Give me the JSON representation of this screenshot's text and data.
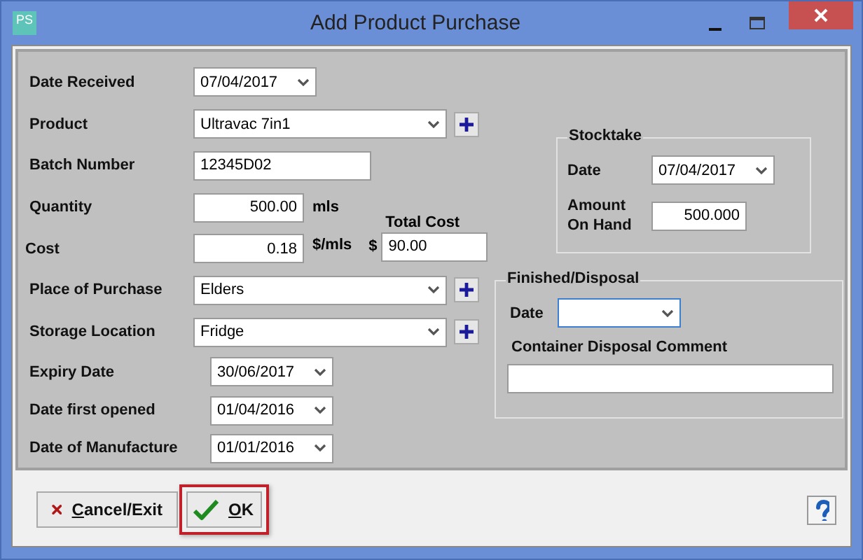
{
  "window": {
    "title": "Add Product Purchase",
    "app_icon_text": "PS"
  },
  "fields": [
    {
      "kind": "date",
      "label": "Date Received",
      "value": "07/04/2017"
    },
    {
      "kind": "combo",
      "label": "Product",
      "value": "Ultravac 7in1",
      "add": true
    },
    {
      "kind": "text",
      "label": "Batch Number",
      "value": "12345D02"
    },
    {
      "kind": "number",
      "label": "Quantity",
      "value": "500.00",
      "unit": "mls"
    },
    {
      "kind": "number",
      "label": "Cost",
      "value": "0.18",
      "unit": "$/mls",
      "total": {
        "label": "Total Cost",
        "currency": "$",
        "value": "90.00"
      }
    },
    {
      "kind": "combo",
      "label": "Place of Purchase",
      "value": "Elders",
      "add": true
    },
    {
      "kind": "combo",
      "label": "Storage Location",
      "value": "Fridge",
      "add": true
    }
  ],
  "dates": [
    {
      "label": "Expiry Date",
      "value": "30/06/2017"
    },
    {
      "label": "Date first opened",
      "value": "01/04/2016"
    },
    {
      "label": "Date of Manufacture",
      "value": "01/01/2016"
    }
  ],
  "stocktake": {
    "title": "Stocktake",
    "date_label": "Date",
    "date": "07/04/2017",
    "amount_label": "Amount On Hand",
    "amount": "500.000"
  },
  "disposal": {
    "title": "Finished/Disposal",
    "date_label": "Date",
    "date_focused": true,
    "comment_label": "Container Disposal Comment"
  },
  "buttons": [
    {
      "kind": "cancel",
      "label": "Cancel/Exit",
      "focused": false
    },
    {
      "kind": "ok",
      "label": "OK",
      "focused": true
    }
  ]
}
